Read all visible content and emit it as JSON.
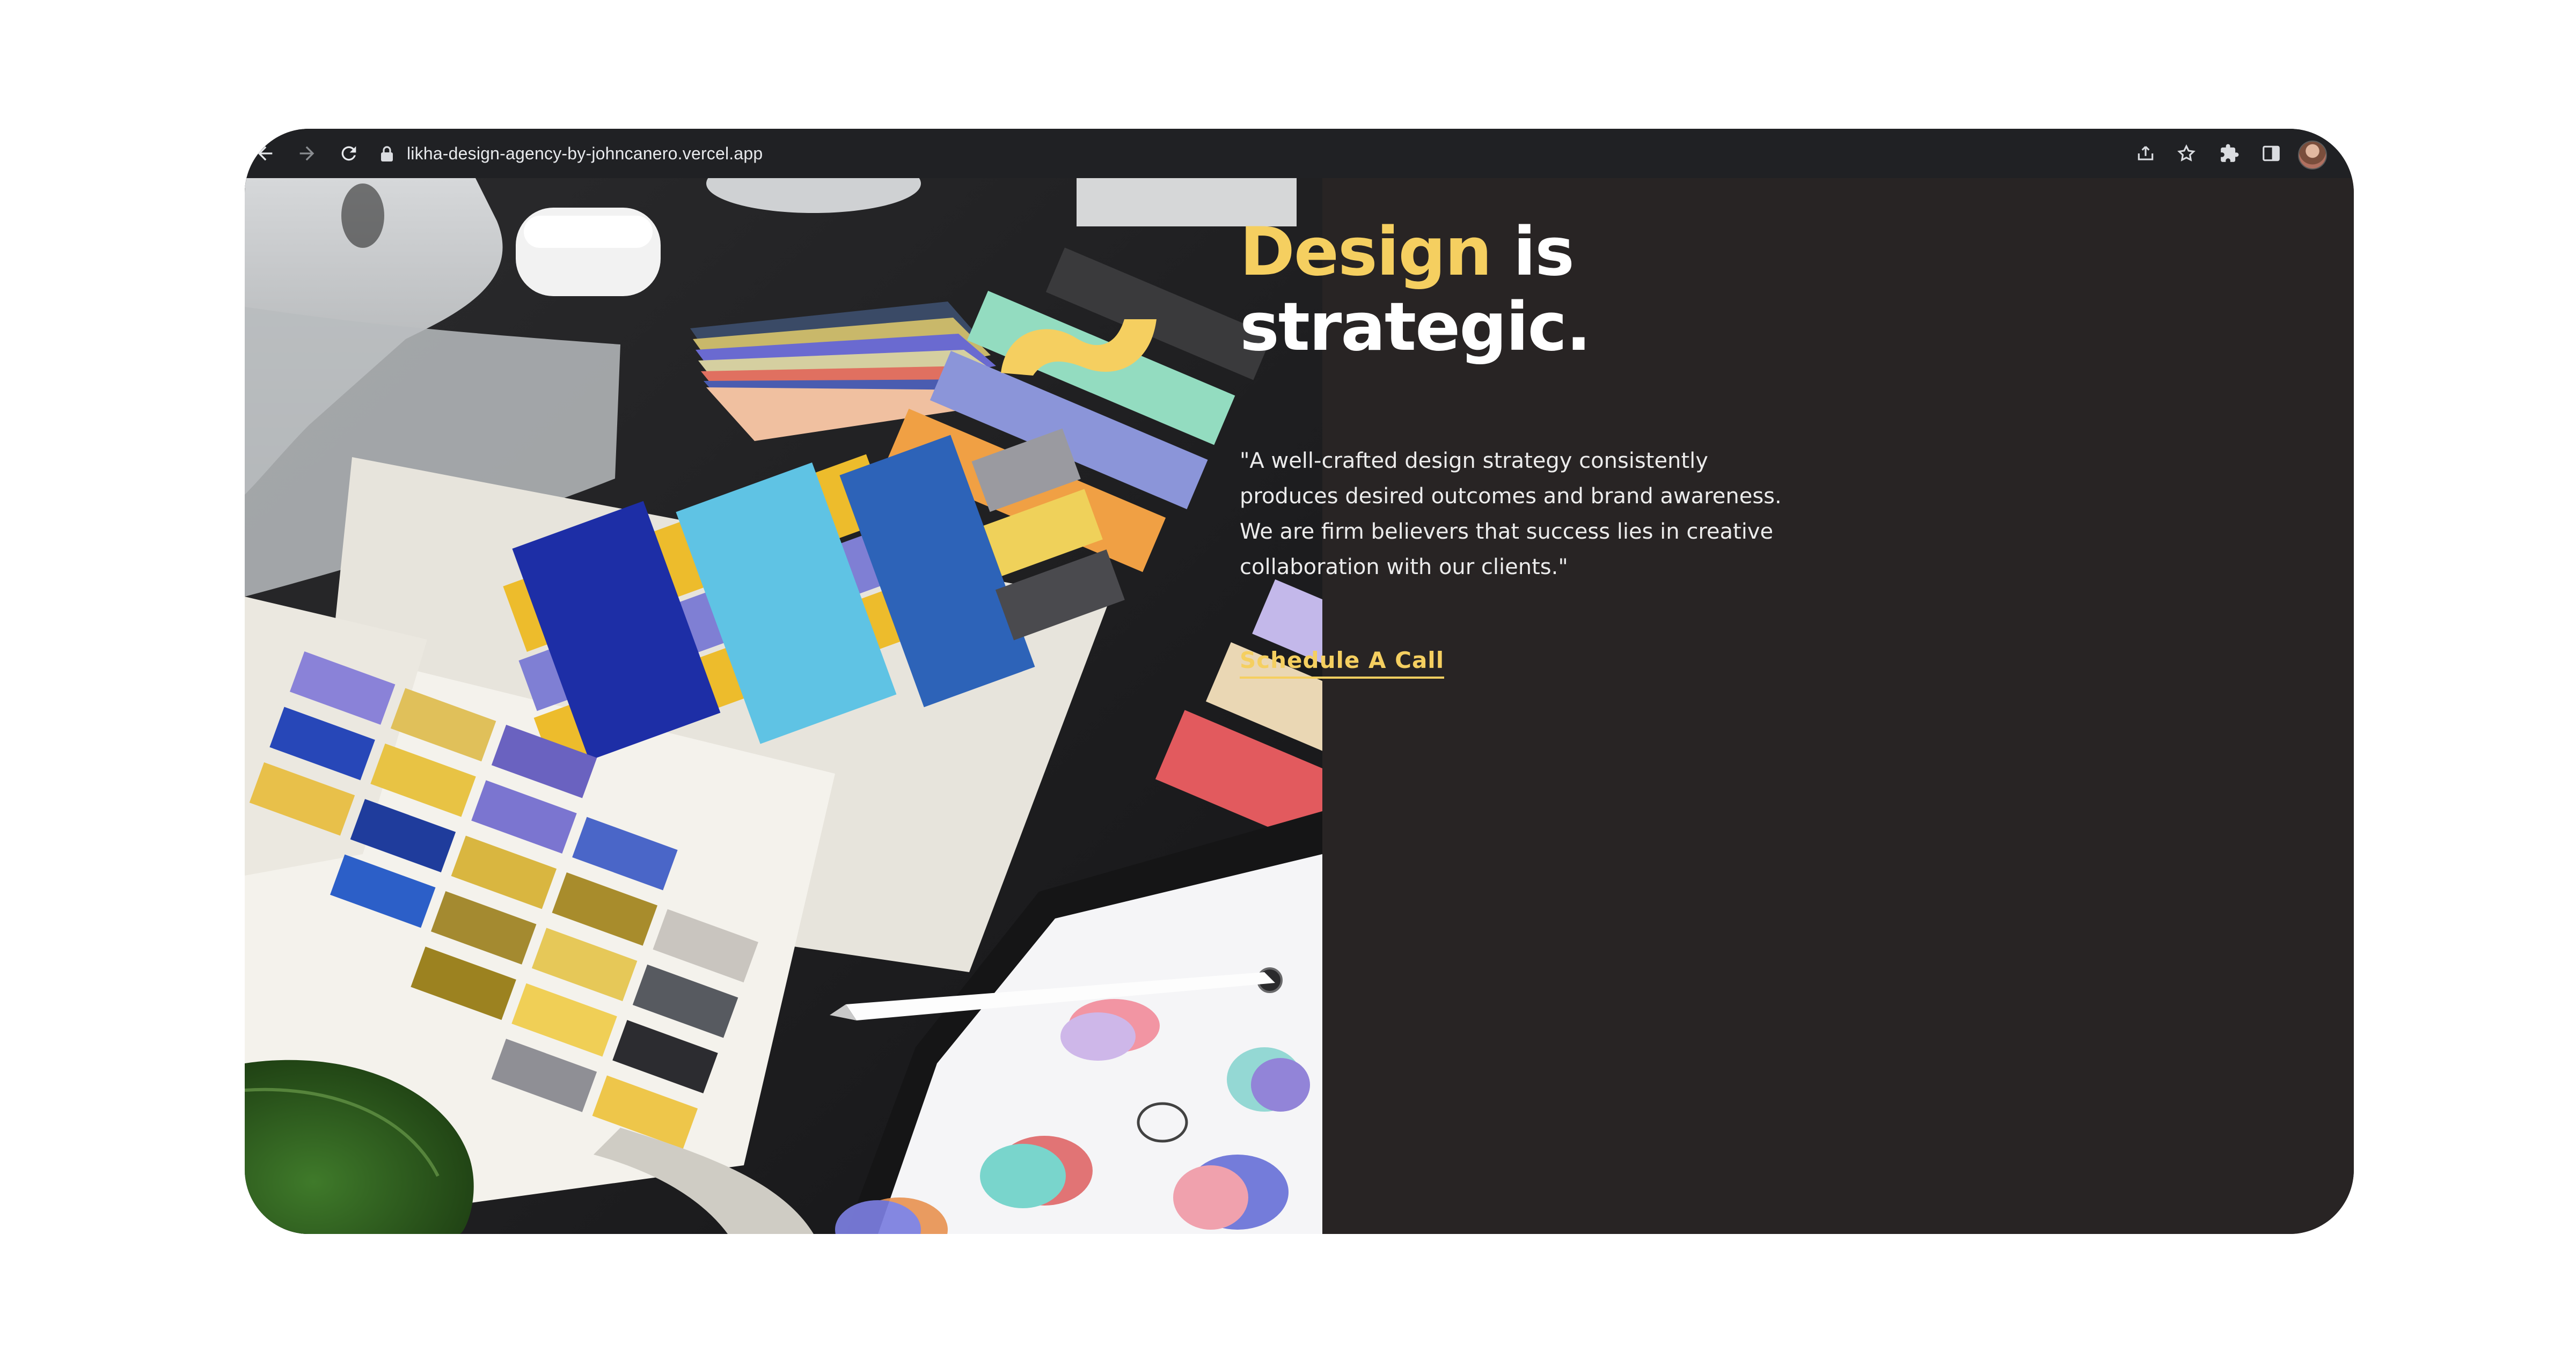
{
  "browser": {
    "url": "likha-design-agency-by-johncanero.vercel.app",
    "icons": [
      "back-arrow-icon",
      "forward-arrow-icon",
      "reload-icon",
      "lock-icon",
      "share-icon",
      "star-icon",
      "extensions-icon",
      "side-panel-icon",
      "profile-avatar"
    ]
  },
  "hero": {
    "title_accent": "Design",
    "title_rest_1": " is",
    "title_line_2": "strategic.",
    "quote": "\"A well-crafted design strategy consistently produces desired outcomes and brand awareness. We are firm believers that success lies in creative collaboration with our clients.\"",
    "cta_label": "Schedule A Call"
  },
  "colors": {
    "background": "#282424",
    "accent": "#f5cf60",
    "text": "#ffffff",
    "chrome": "#202124"
  }
}
